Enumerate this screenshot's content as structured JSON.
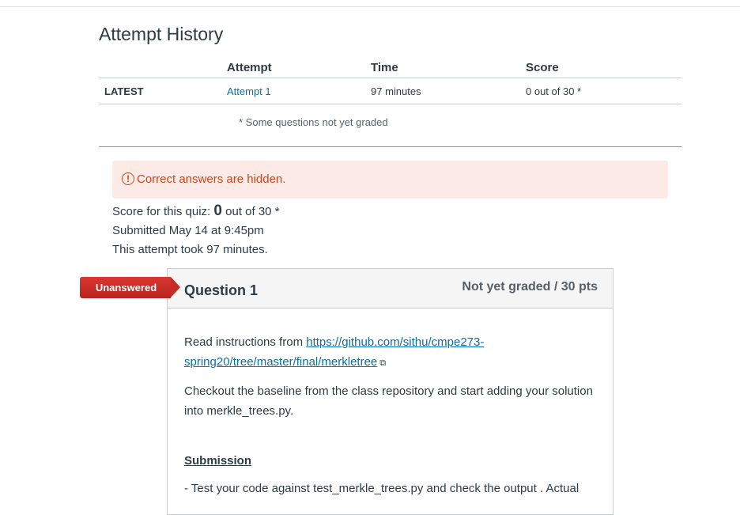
{
  "history": {
    "title": "Attempt History",
    "headers": {
      "blank": "",
      "attempt": "Attempt",
      "time": "Time",
      "score": "Score"
    },
    "row": {
      "label": "LATEST",
      "attempt": "Attempt 1",
      "time": "97 minutes",
      "score": "0 out of 30 *"
    },
    "footnote": "* Some questions not yet graded"
  },
  "alert": {
    "icon": "alert-circle-icon",
    "text": "Correct answers are hidden."
  },
  "summary": {
    "score_prefix": "Score for this quiz: ",
    "score_value": "0",
    "score_suffix": " out of 30 *",
    "submitted": "Submitted May 14 at 9:45pm",
    "duration": "This attempt took 97 minutes."
  },
  "question": {
    "flag": "Unanswered",
    "name": "Question 1",
    "points": "Not yet graded / 30 pts",
    "intro": "Read instructions from ",
    "link": "https://github.com/sithu/cmpe273-spring20/tree/master/final/merkletree",
    "link_icon": "external-link-icon",
    "para2": "Checkout the baseline from the class repository and start adding your solution into merkle_trees.py.",
    "submission_heading": "Submission",
    "para3": "- Test your code against test_merkle_trees.py and check the output .  Actual"
  }
}
